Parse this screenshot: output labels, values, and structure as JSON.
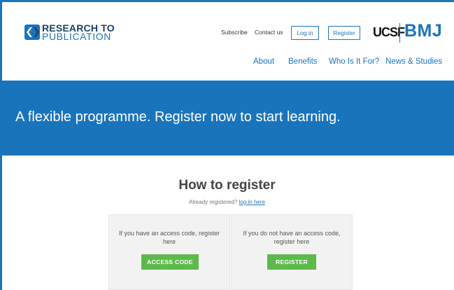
{
  "brand": {
    "logo_line1": "RESEARCH TO",
    "logo_line2": "PUBLICATION",
    "partner1": "UCSF",
    "partner2": "BMJ"
  },
  "top_nav": {
    "subscribe": "Subscribe",
    "contact": "Contact us",
    "login": "Log in",
    "register": "Register"
  },
  "main_nav": [
    "About",
    "Benefits",
    "Who Is It For?",
    "News & Studies"
  ],
  "banner": {
    "headline": "A flexible programme. Register now to start learning."
  },
  "register": {
    "title": "How to register",
    "already_text": "Already registered?",
    "login_link": "log in here",
    "options": [
      {
        "text": "If you have an access code, register here",
        "button": "ACCESS CODE"
      },
      {
        "text": "If you do not have an access code, register here",
        "button": "REGISTER"
      }
    ]
  },
  "colors": {
    "accent": "#1a74bc",
    "button_green": "#5db94b",
    "navy": "#1e3e66"
  }
}
